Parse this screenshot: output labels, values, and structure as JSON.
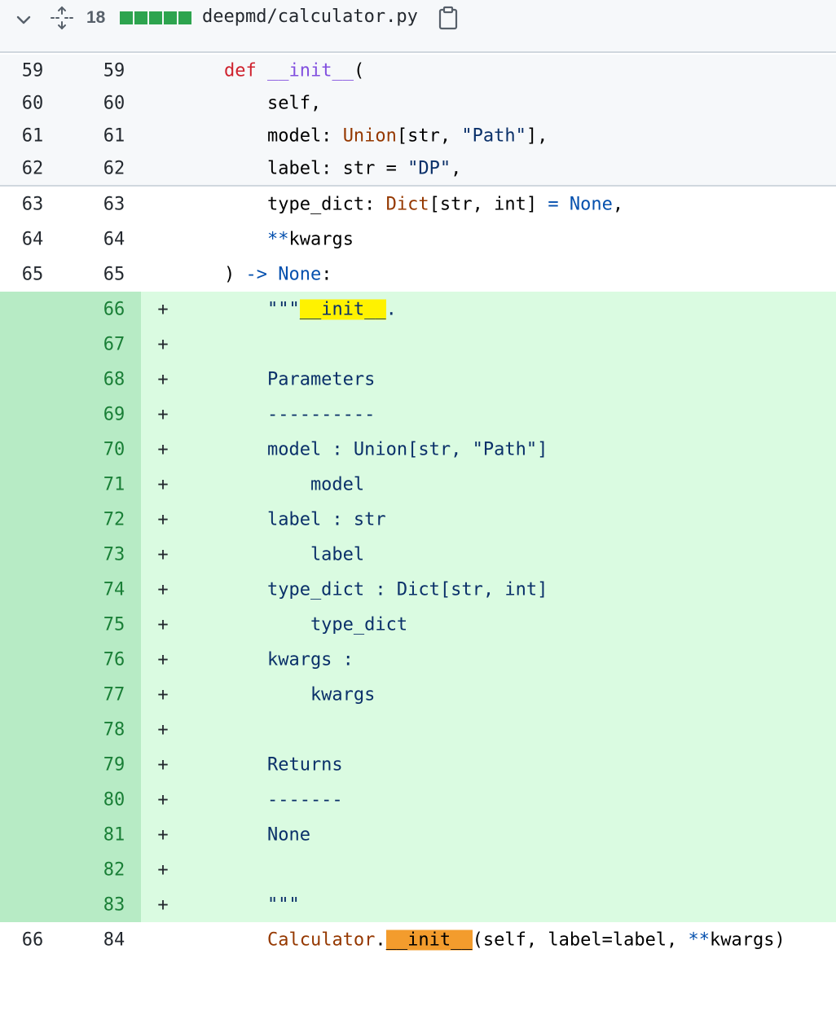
{
  "file": {
    "changes": "18",
    "name": "deepmd/calculator.py",
    "diffstat_colors": [
      "#2da44e",
      "#2da44e",
      "#2da44e",
      "#2da44e",
      "#2da44e"
    ],
    "icons": [
      "chevron-down-icon",
      "expand-icon",
      "copy-icon"
    ]
  },
  "context_expanded": [
    {
      "o": "59",
      "n": "59",
      "code": "    def __init__("
    },
    {
      "o": "60",
      "n": "60",
      "code": "        self,"
    },
    {
      "o": "61",
      "n": "61",
      "code": "        model: Union[str, \"Path\"],"
    },
    {
      "o": "62",
      "n": "62",
      "code": "        label: str = \"DP\","
    }
  ],
  "context": [
    {
      "o": "63",
      "n": "63",
      "code": "        type_dict: Dict[str, int] = None,"
    },
    {
      "o": "64",
      "n": "64",
      "code": "        **kwargs"
    },
    {
      "o": "65",
      "n": "65",
      "code": "    ) -> None:"
    }
  ],
  "added": [
    {
      "n": "66",
      "sign": "+",
      "code": "        \"\"\"__init__."
    },
    {
      "n": "67",
      "sign": "+",
      "code": ""
    },
    {
      "n": "68",
      "sign": "+",
      "code": "        Parameters"
    },
    {
      "n": "69",
      "sign": "+",
      "code": "        ----------"
    },
    {
      "n": "70",
      "sign": "+",
      "code": "        model : Union[str, \"Path\"]"
    },
    {
      "n": "71",
      "sign": "+",
      "code": "            model"
    },
    {
      "n": "72",
      "sign": "+",
      "code": "        label : str"
    },
    {
      "n": "73",
      "sign": "+",
      "code": "            label"
    },
    {
      "n": "74",
      "sign": "+",
      "code": "        type_dict : Dict[str, int]"
    },
    {
      "n": "75",
      "sign": "+",
      "code": "            type_dict"
    },
    {
      "n": "76",
      "sign": "+",
      "code": "        kwargs :"
    },
    {
      "n": "77",
      "sign": "+",
      "code": "            kwargs"
    },
    {
      "n": "78",
      "sign": "+",
      "code": ""
    },
    {
      "n": "79",
      "sign": "+",
      "code": "        Returns"
    },
    {
      "n": "80",
      "sign": "+",
      "code": "        -------"
    },
    {
      "n": "81",
      "sign": "+",
      "code": "        None"
    },
    {
      "n": "82",
      "sign": "+",
      "code": ""
    },
    {
      "n": "83",
      "sign": "+",
      "code": "        \"\"\""
    }
  ],
  "tail": {
    "o": "66",
    "n": "84",
    "code": "        Calculator.__init__(self, label=label, **kwargs)"
  }
}
